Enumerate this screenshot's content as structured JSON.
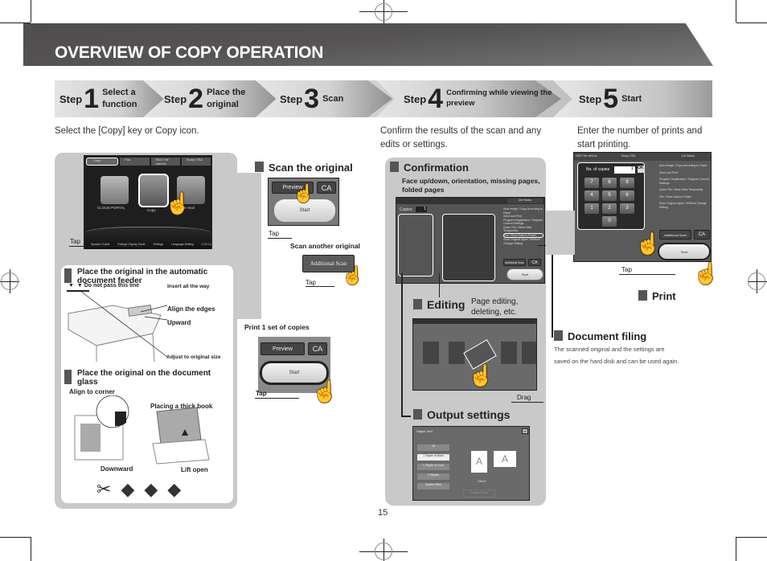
{
  "header": {
    "title": "OVERVIEW OF COPY OPERATION"
  },
  "steps": [
    {
      "label": "Step",
      "number": "1",
      "text_line1": "Select a",
      "text_line2": "function"
    },
    {
      "label": "Step",
      "number": "2",
      "text_line1": "Place the",
      "text_line2": "original"
    },
    {
      "label": "Step",
      "number": "3",
      "text_line1": "Scan",
      "text_line2": ""
    },
    {
      "label": "Step",
      "number": "4",
      "text_line1": "Confirming while viewing the",
      "text_line2": "preview"
    },
    {
      "label": "Step",
      "number": "5",
      "text_line1": "Start",
      "text_line2": ""
    }
  ],
  "descriptions": {
    "step1": "Select the [Copy] key or Copy icon.",
    "step4": "Confirm the results of the scan and any edits or settings.",
    "step5": "Enter the number of prints and start printing."
  },
  "home_screen": {
    "tabs": [
      "Copy",
      "Fax",
      "HDD File retrieve",
      "Sharp OSA"
    ],
    "icons": [
      "CLOUD PORTAL",
      "Copy",
      "E-mail"
    ],
    "bottom": [
      "Speaker Guide",
      "Enlarge Display Mode",
      "Settings",
      "Language Setting",
      "LCD Co"
    ],
    "tap": "Tap"
  },
  "adf": {
    "title": "Place the original in the automatic document feeder",
    "do_not_pass": "Do not pass this line",
    "insert": "Insert all the way",
    "align": "Align the edges",
    "upward": "Upward",
    "adjust": "Adjust to original size"
  },
  "glass": {
    "title": "Place the original on the document glass",
    "align_corner": "Align to corner",
    "thick_book": "Placing a thick book",
    "downward": "Downward",
    "lift": "Lift open"
  },
  "scan": {
    "title": "Scan the original",
    "preview": "Preview",
    "ca": "CA",
    "start": "Start",
    "tap": "Tap",
    "another": "Scan another original",
    "additional": "Additional Scan",
    "tap2": "Tap"
  },
  "print1": {
    "title": "Print 1 set of copies",
    "preview": "Preview",
    "ca": "CA",
    "start": "Start",
    "tap": "Tap"
  },
  "confirmation": {
    "title": "Confirmation",
    "note": "Face up/down, orientation, missing pages, folded pages",
    "copies_label": "Copies",
    "copies_value": "1",
    "job_status": "Job Status",
    "side_items": [
      "Auto Image / Copy According to Paper",
      "Send and Print",
      "Program Registration / Register Current Settings",
      "Quick File / Store Data Temporarily",
      "File / Store Data in Folder",
      "Scan Original Again / Without Change Setting"
    ],
    "additional": "Additional Scan",
    "ca": "CA",
    "start": "Start"
  },
  "editing": {
    "title": "Editing",
    "note": "Page editing, deleting, etc.",
    "drag": "Drag"
  },
  "output": {
    "title": "Output settings",
    "dialog_title": "Staple Sort",
    "ok": "OK",
    "options": [
      "Off",
      "1 Staple at Back",
      "1 Staple at Front",
      "2 Staples",
      "Saddle Stitch"
    ],
    "offset": "Offset",
    "output_tray": "Output Tray"
  },
  "start_screen": {
    "tabs": [
      "HDD File retrieve",
      "Sharp OSA",
      "Job Status"
    ],
    "copies_label": "No. of copies",
    "copies_value": "1",
    "ok": "OK",
    "keys": [
      "7",
      "8",
      "9",
      "4",
      "5",
      "6",
      "1",
      "2",
      "3",
      "0"
    ],
    "additional": "Additional Scan",
    "ca": "CA",
    "start": "Start",
    "tap": "Tap"
  },
  "print": {
    "title": "Print"
  },
  "filing": {
    "title": "Document filing",
    "line1": "The scanned original and the settings are",
    "line2": "saved on the hard disk and can be used again."
  },
  "page_number": "15"
}
